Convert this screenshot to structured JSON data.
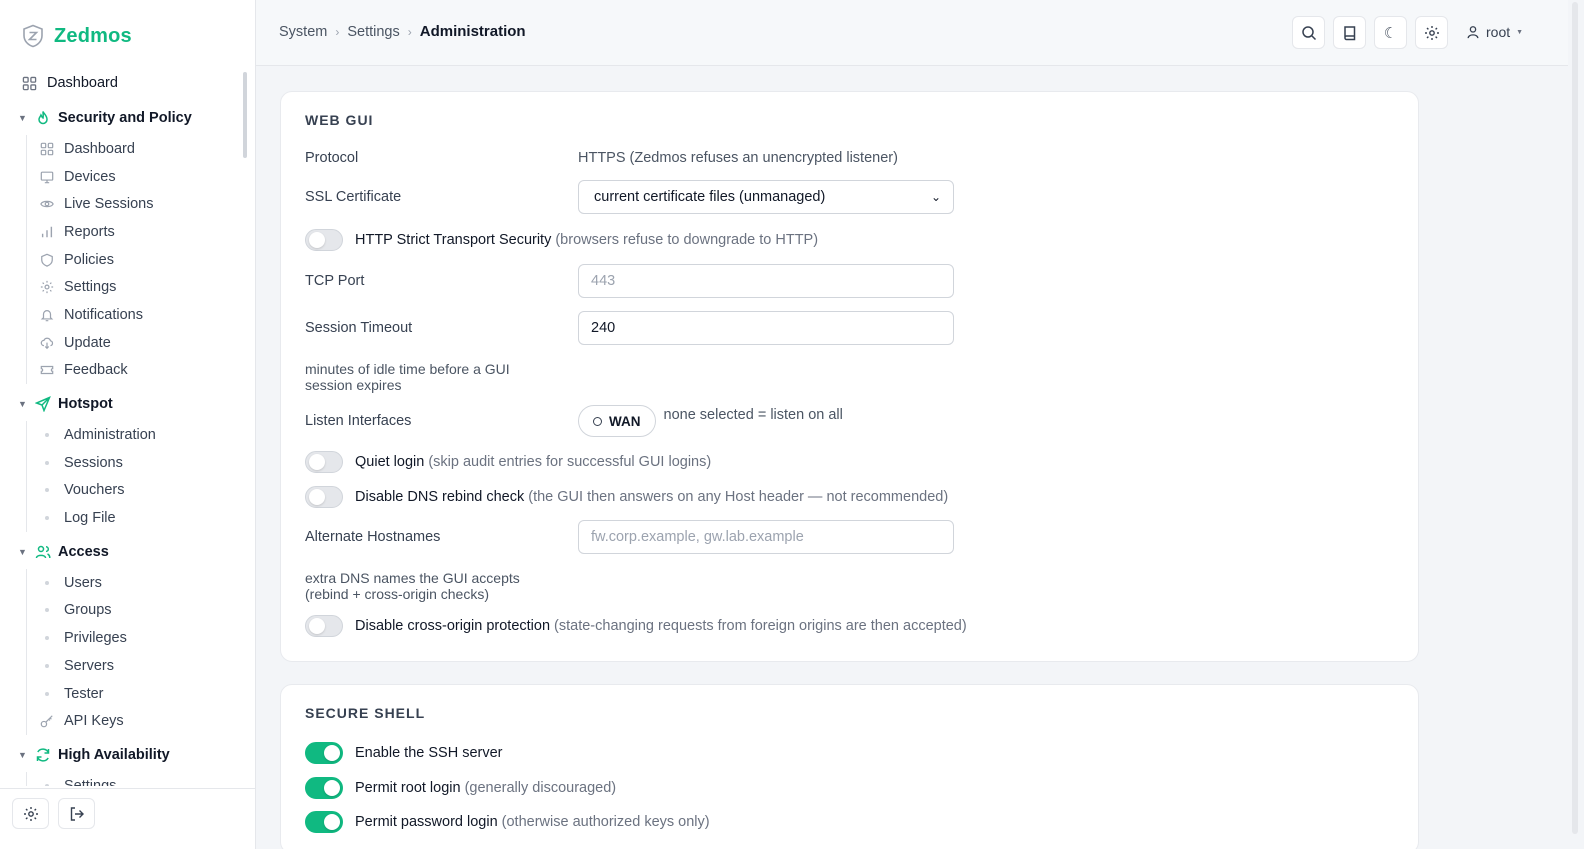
{
  "app": {
    "name": "Zedmos"
  },
  "sidebar": {
    "top_item": "Dashboard",
    "groups": [
      {
        "label": "Security and Policy",
        "items": [
          "Dashboard",
          "Devices",
          "Live Sessions",
          "Reports",
          "Policies",
          "Settings",
          "Notifications",
          "Update",
          "Feedback"
        ]
      },
      {
        "label": "Hotspot",
        "items": [
          "Administration",
          "Sessions",
          "Vouchers",
          "Log File"
        ]
      },
      {
        "label": "Access",
        "items": [
          "Users",
          "Groups",
          "Privileges",
          "Servers",
          "Tester",
          "API Keys"
        ]
      },
      {
        "label": "High Availability",
        "items": [
          "Settings"
        ]
      }
    ]
  },
  "header": {
    "breadcrumb": [
      "System",
      "Settings",
      "Administration"
    ],
    "user": "root"
  },
  "webgui": {
    "title": "WEB GUI",
    "protocol_label": "Protocol",
    "protocol_value": "HTTPS (Zedmos refuses an unencrypted listener)",
    "ssl_label": "SSL Certificate",
    "ssl_value": "current certificate files (unmanaged)",
    "hsts_label": "HTTP Strict Transport Security",
    "hsts_desc": "(browsers refuse to downgrade to HTTP)",
    "hsts_on": false,
    "tcp_label": "TCP Port",
    "tcp_placeholder": "443",
    "timeout_label": "Session Timeout",
    "timeout_value": "240",
    "timeout_help": "minutes of idle time before a GUI session expires",
    "listen_label": "Listen Interfaces",
    "listen_chip": "WAN",
    "listen_hint": "none selected = listen on all",
    "quiet_label": "Quiet login",
    "quiet_desc": "(skip audit entries for successful GUI logins)",
    "quiet_on": false,
    "dns_label": "Disable DNS rebind check",
    "dns_desc": "(the GUI then answers on any Host header — not recommended)",
    "dns_on": false,
    "alt_label": "Alternate Hostnames",
    "alt_placeholder": "fw.corp.example, gw.lab.example",
    "alt_help": "extra DNS names the GUI accepts (rebind + cross-origin checks)",
    "cors_label": "Disable cross-origin protection",
    "cors_desc": "(state-changing requests from foreign origins are then accepted)",
    "cors_on": false
  },
  "ssh": {
    "title": "SECURE SHELL",
    "enable_label": "Enable the SSH server",
    "enable_on": true,
    "root_label": "Permit root login",
    "root_desc": "(generally discouraged)",
    "root_on": true,
    "password_label": "Permit password login",
    "password_desc": "(otherwise authorized keys only)",
    "password_on": true
  },
  "colors": {
    "accent": "#10b981",
    "toggle_off": "#e5e7eb"
  }
}
